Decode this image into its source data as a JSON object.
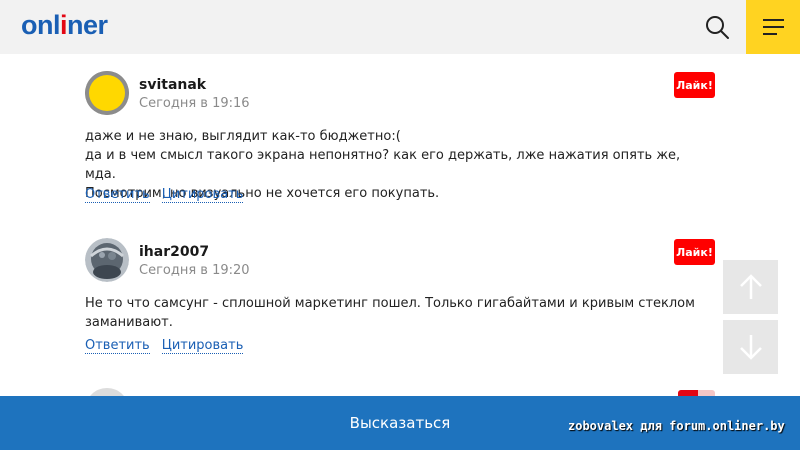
{
  "header": {
    "logo_pre": "onl",
    "logo_accent": "i",
    "logo_post": "ner",
    "search_icon": "search-icon",
    "menu_icon": "hamburger-icon"
  },
  "comments": [
    {
      "author": "svitanak",
      "time": "Сегодня в 19:16",
      "like_label": "Лайк!",
      "lines": [
        "даже и не знаю, выглядит как-то бюджетно:(",
        "да и в чем смысл такого экрана непонятно? как его держать, лже нажатия опять же, мда.",
        "Посмотрим, но визуально не хочется его покупать."
      ],
      "reply_label": "Ответить",
      "quote_label": "Цитировать"
    },
    {
      "author": "ihar2007",
      "time": "Сегодня в 19:20",
      "like_label": "Лайк!",
      "lines": [
        "Не то что самсунг - сплошной маркетинг пошел. Только гигабайтами и кривым стеклом",
        "заманивают."
      ],
      "reply_label": "Ответить",
      "quote_label": "Цитировать"
    }
  ],
  "scroll": {
    "up_icon": "arrow-up-icon",
    "down_icon": "arrow-down-icon"
  },
  "footer": {
    "reply_button": "Высказаться"
  },
  "watermark": "zobovalex для forum.onliner.by",
  "colors": {
    "brand_blue": "#1a5fb4",
    "footer_blue": "#1e73be",
    "like_red": "#ff0000",
    "menu_yellow": "#ffd321",
    "avatar_yellow": "#ffd800"
  }
}
